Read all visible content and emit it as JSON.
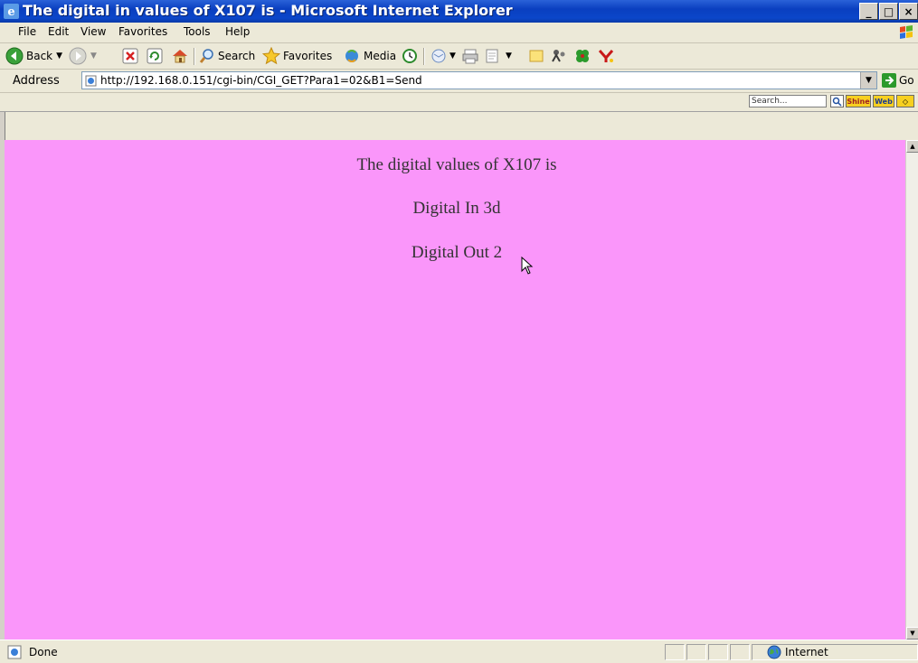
{
  "window": {
    "title": "The digital in values of X107 is - Microsoft Internet Explorer",
    "controls": {
      "minimize": "_",
      "maximize": "□",
      "close": "×"
    }
  },
  "menu": {
    "items": [
      "File",
      "Edit",
      "View",
      "Favorites",
      "Tools",
      "Help"
    ]
  },
  "toolbar": {
    "back_label": "Back",
    "search_label": "Search",
    "favorites_label": "Favorites",
    "media_label": "Media"
  },
  "address": {
    "label": "Address",
    "url": "http://192.168.0.151/cgi-bin/CGI_GET?Para1=02&B1=Send",
    "go_label": "Go"
  },
  "links": {
    "search_placeholder": "Search...",
    "shine_label": "Shine",
    "web_label": "Web"
  },
  "content": {
    "heading": "The digital values of X107 is",
    "digital_in": "Digital In 3d",
    "digital_out": "Digital Out 2"
  },
  "status": {
    "text": "Done",
    "zone": "Internet"
  },
  "colors": {
    "page_background": "#fa96fa",
    "titlebar": "#0a3fc0"
  }
}
